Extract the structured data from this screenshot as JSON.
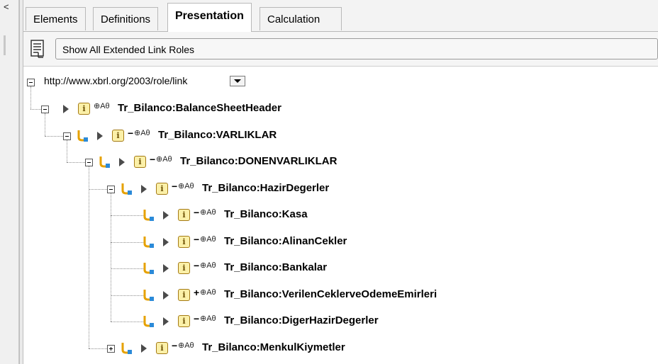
{
  "left_strip": {
    "collapse_glyph": "<"
  },
  "tabs": [
    {
      "label": "Elements",
      "active": false
    },
    {
      "label": "Definitions",
      "active": false
    },
    {
      "label": "Presentation",
      "active": true
    },
    {
      "label": "Calculation",
      "active": false
    }
  ],
  "toolbar": {
    "icon": "tree-list-icon",
    "role_button_label": "Show All Extended Link Roles"
  },
  "tree": {
    "role_label": "http://www.xbrl.org/2003/role/link",
    "role_dropdown_icon": "chevron-down-icon",
    "nodes": [
      {
        "label": "Tr_Bilanco:BalanceSheetHeader",
        "sign": "",
        "flags": "⊕Aθ",
        "level": 0,
        "expander": "minus",
        "has_link": false
      },
      {
        "label": "Tr_Bilanco:VARLIKLAR",
        "sign": "−",
        "flags": "⊕Aθ",
        "level": 1,
        "expander": "minus",
        "has_link": true
      },
      {
        "label": "Tr_Bilanco:DONENVARLIKLAR",
        "sign": "−",
        "flags": "⊕Aθ",
        "level": 2,
        "expander": "minus",
        "has_link": true
      },
      {
        "label": "Tr_Bilanco:HazirDegerler",
        "sign": "−",
        "flags": "⊕Aθ",
        "level": 3,
        "expander": "minus",
        "has_link": true
      },
      {
        "label": "Tr_Bilanco:Kasa",
        "sign": "−",
        "flags": "⊕Aθ",
        "level": 4,
        "expander": "",
        "has_link": true
      },
      {
        "label": "Tr_Bilanco:AlinanCekler",
        "sign": "−",
        "flags": "⊕Aθ",
        "level": 4,
        "expander": "",
        "has_link": true
      },
      {
        "label": "Tr_Bilanco:Bankalar",
        "sign": "−",
        "flags": "⊕Aθ",
        "level": 4,
        "expander": "",
        "has_link": true
      },
      {
        "label": "Tr_Bilanco:VerilenCeklerveOdemeEmirleri",
        "sign": "+",
        "flags": "⊕Aθ",
        "level": 4,
        "expander": "",
        "has_link": true
      },
      {
        "label": "Tr_Bilanco:DigerHazirDegerler",
        "sign": "−",
        "flags": "⊕Aθ",
        "level": 4,
        "expander": "",
        "has_link": true
      },
      {
        "label": "Tr_Bilanco:MenkulKiymetler",
        "sign": "−",
        "flags": "⊕Aθ",
        "level": 3,
        "expander": "plus",
        "has_link": true
      }
    ]
  }
}
